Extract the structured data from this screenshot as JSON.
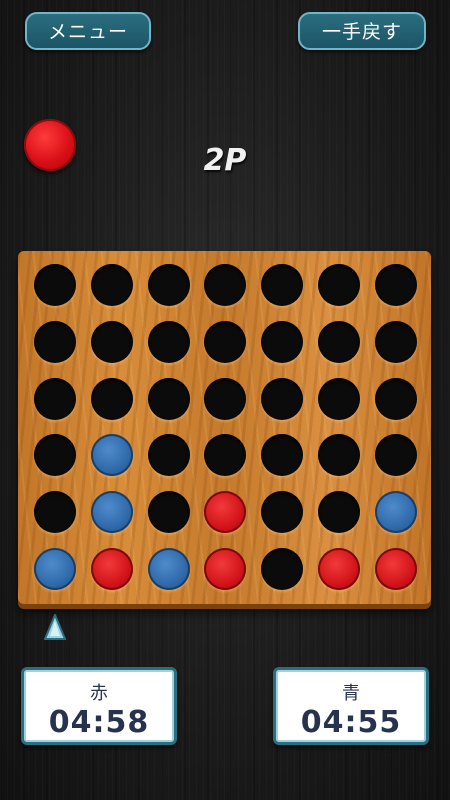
{
  "header": {
    "menu_label": "メニュー",
    "undo_label": "一手戻す"
  },
  "status": {
    "current_turn": "red",
    "mode": "2P"
  },
  "board": {
    "columns": 7,
    "rows": 6,
    "cells": [
      [
        "empty",
        "empty",
        "empty",
        "empty",
        "empty",
        "empty",
        "empty"
      ],
      [
        "empty",
        "empty",
        "empty",
        "empty",
        "empty",
        "empty",
        "empty"
      ],
      [
        "empty",
        "empty",
        "empty",
        "empty",
        "empty",
        "empty",
        "empty"
      ],
      [
        "empty",
        "blue",
        "empty",
        "empty",
        "empty",
        "empty",
        "empty"
      ],
      [
        "empty",
        "blue",
        "empty",
        "red",
        "empty",
        "empty",
        "blue"
      ],
      [
        "blue",
        "red",
        "blue",
        "red",
        "empty",
        "red",
        "red"
      ]
    ],
    "selected_column": 1
  },
  "timers": {
    "red": {
      "label": "赤",
      "time": "04:58"
    },
    "blue": {
      "label": "青",
      "time": "04:55"
    }
  },
  "colors": {
    "red_disc": "#d01218",
    "blue_disc": "#2e68a8",
    "button_fill": "#1f5f70",
    "button_border": "#6fb6c9",
    "board_wood": "#cf8433"
  },
  "icons": {
    "turn_indicator": "red-disc-icon",
    "column_marker": "up-triangle-icon"
  }
}
